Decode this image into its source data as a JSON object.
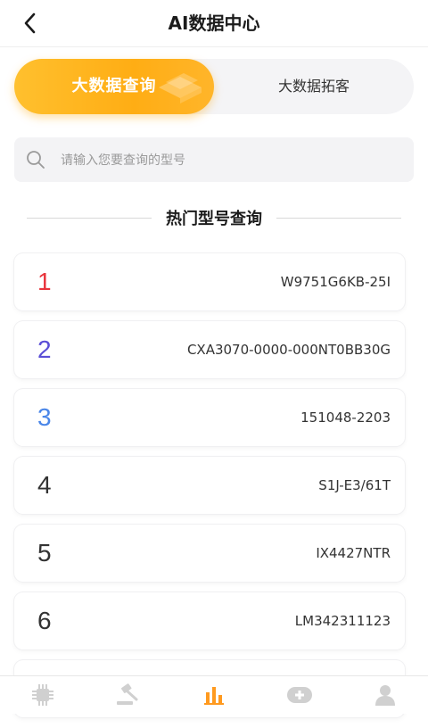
{
  "header": {
    "title": "AI数据中心",
    "back_icon": "chevron-left-icon"
  },
  "tabs": [
    {
      "label": "大数据查询",
      "active": true
    },
    {
      "label": "大数据拓客",
      "active": false
    }
  ],
  "search": {
    "placeholder": "请输入您要查询的型号",
    "value": "",
    "icon": "search-icon"
  },
  "section": {
    "title": "热门型号查询"
  },
  "hot_models": [
    {
      "rank": "1",
      "model": "W9751G6KB-25I",
      "color": "#e8343c"
    },
    {
      "rank": "2",
      "model": "CXA3070-0000-000NT0BB30G",
      "color": "#5a4ed6"
    },
    {
      "rank": "3",
      "model": "151048-2203",
      "color": "#4a86e8"
    },
    {
      "rank": "4",
      "model": "S1J-E3/61T",
      "color": "#333333"
    },
    {
      "rank": "5",
      "model": "IX4427NTR",
      "color": "#333333"
    },
    {
      "rank": "6",
      "model": "LM342311123",
      "color": "#333333"
    }
  ],
  "colors": {
    "accent": "#ffad14",
    "tab_icon_inactive": "#d0d0d0",
    "tab_icon_active": "#ff9a1f"
  },
  "tabbar": [
    {
      "icon": "chip-icon",
      "active": false
    },
    {
      "icon": "gavel-icon",
      "active": false
    },
    {
      "icon": "bar-chart-icon",
      "active": true
    },
    {
      "icon": "game-controller-icon",
      "active": false
    },
    {
      "icon": "user-icon",
      "active": false
    }
  ]
}
